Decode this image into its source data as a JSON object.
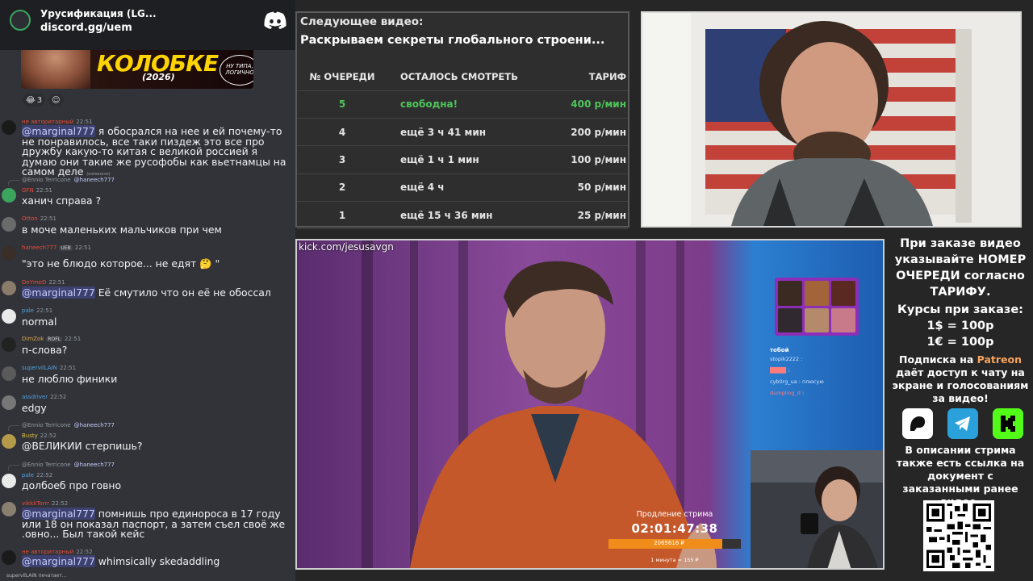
{
  "discord": {
    "server_name": "Урусификация (LG...",
    "invite_link": "discord.gg/uem",
    "embed": {
      "title": "КОЛОБКЕ",
      "year": "(2026)",
      "badge": "НУ ТИПА, ЛОГИЧНО"
    },
    "reactions": [
      {
        "emoji": "😂",
        "count": "3"
      },
      {
        "emoji": "☺",
        "count": ""
      }
    ],
    "messages": [
      {
        "user": "не авторитарный",
        "user_color": "#e74c3c",
        "time": "22:51",
        "mention": "@marginal777",
        "text": " я обосрался на нее и ей почему-то не понравилось, все таки пиздеж это все про дружбу какую-то китая с великой россией я думаю они такие же русофобы как вьетнамцы на самом деле",
        "edited": "(изменено)"
      },
      {
        "reply_from": "@Ennio Terricone",
        "reply_to": "@haneech777",
        "user": "GFN",
        "user_color": "#e74c3c",
        "time": "22:51",
        "text": "ханич справа ?"
      },
      {
        "user": "Otton",
        "user_color": "#e74c3c",
        "time": "22:51",
        "text": "в моче маленьких мальчиков при чем"
      },
      {
        "user": "haneech777",
        "user_color": "#e74c3c",
        "badge": "UEB",
        "time": "22:51",
        "text": "\"это не блюдо которое... не едят 🤔 \""
      },
      {
        "user": "DeYmeD",
        "user_color": "#e74c3c",
        "time": "22:51",
        "mention": "@marginal777",
        "text": " Её смутило что он её не обоссал"
      },
      {
        "user": "pale",
        "user_color": "#4fa3e0",
        "time": "22:51",
        "text": "normal"
      },
      {
        "user": "DimZok",
        "user_color": "#d6a84b",
        "badge": "ROFL",
        "time": "22:51",
        "text": "п-слова?"
      },
      {
        "user": "supervilLAIN",
        "user_color": "#4fa3e0",
        "time": "22:51",
        "text": "не люблю финики"
      },
      {
        "user": "assdriver",
        "user_color": "#4fa3e0",
        "time": "22:52",
        "text": "edgy"
      },
      {
        "reply_from": "@Ennio Terricone",
        "reply_to": "@haneech777",
        "user": "Busty",
        "user_color": "#e2c24a",
        "time": "22:52",
        "text": "@ВЕЛИКИИ стерпишь?"
      },
      {
        "reply_from": "@Ennio Terricone",
        "reply_to": "@haneech777",
        "user": "pale",
        "user_color": "#4fa3e0",
        "time": "22:52",
        "text": "долбоеб про говно"
      },
      {
        "user": "vikkkTorrr",
        "user_color": "#e74c3c",
        "time": "22:52",
        "mention": "@marginal777",
        "text": " помнишь про единороса в 17 году или 18 он показал паспорт, а затем съел своё же .овно... Был такой кейс"
      },
      {
        "user": "не авторитарный",
        "user_color": "#e74c3c",
        "time": "22:52",
        "mention": "@marginal777",
        "text": " whimsically skedaddling"
      }
    ],
    "typing": "supervilLAIN печатает..."
  },
  "queue": {
    "next_label": "Следующее видео:",
    "next_title": "Раскрываем секреты глобального строени...",
    "headers": [
      "№ ОЧЕРЕДИ",
      "ОСТАЛОСЬ СМОТРЕТЬ",
      "ТАРИФ"
    ],
    "rows": [
      {
        "num": "5",
        "left": "свободна!",
        "rate": "400 р/мин",
        "free": true
      },
      {
        "num": "4",
        "left": "ещё 3 ч 41 мин",
        "rate": "200 р/мин",
        "free": false
      },
      {
        "num": "3",
        "left": "ещё 1 ч 1 мин",
        "rate": "100 р/мин",
        "free": false
      },
      {
        "num": "2",
        "left": "ещё 4 ч",
        "rate": "50 р/мин",
        "free": false
      },
      {
        "num": "1",
        "left": "ещё 15 ч 36 мин",
        "rate": "25 р/мин",
        "free": false
      }
    ]
  },
  "video": {
    "kick_url": "kick.com/jesusavgn",
    "extend_label": "Продление стрима",
    "timer": "02:01:47:38",
    "amount": "2065616 ₽",
    "progress": 0.86,
    "rate": "1 минута = 155 ₽",
    "overlay_chat_title": "тобой",
    "overlay_chat": [
      {
        "user": "stopik2222",
        "text": ""
      },
      {
        "user": "████",
        "text": ""
      },
      {
        "user": "cyb0rg_ua",
        "text": "плюсую"
      },
      {
        "user": "dumpling_d",
        "text": ""
      }
    ]
  },
  "info": {
    "order_text": "При заказе видео указывайте НОМЕР ОЧЕРЕДИ согласно ТАРИФУ.",
    "rates_title": "Курсы при заказе:",
    "rate_usd": "1$ = 100р",
    "rate_eur": "1€ = 100р",
    "sub_1": "Подписка на ",
    "patreon": "Patreon",
    "sub_2": " даёт доступ к чату на экране и голосованиям за видео!",
    "description": "В описании стрима также есть ссылка на документ с заказанными ранее видео."
  },
  "colors": {
    "free": "#4fc55a",
    "progress": "#f08c1a",
    "patreon": "#f7a35c",
    "discord_bg": "#313338"
  }
}
